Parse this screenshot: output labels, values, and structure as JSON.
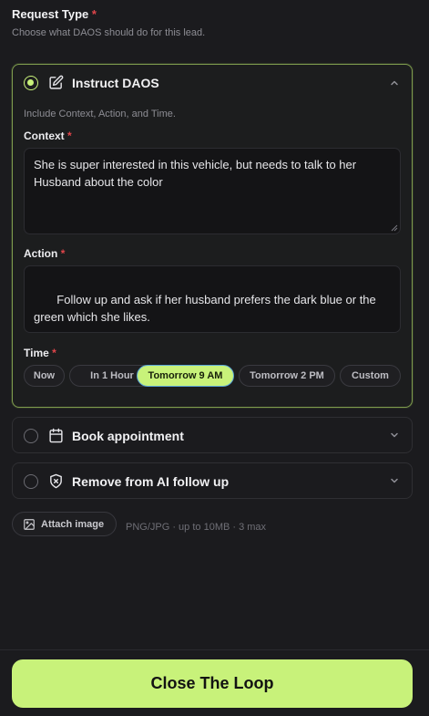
{
  "request_type": {
    "title": "Request Type",
    "required_mark": "*",
    "subtitle": "Choose what DAOS should do for this lead."
  },
  "instruct": {
    "title": "Instruct DAOS",
    "icon": "pencil-square-icon",
    "selected": true,
    "expanded": true,
    "hint": "Include Context, Action, and Time.",
    "context_label": "Context",
    "context_value": "She is super interested in this vehicle, but needs to talk to her Husband about the color",
    "action_label": "Action",
    "action_value": " Follow up and ask if her husband prefers the dark blue or the green which she likes.",
    "time_label": "Time",
    "time_options": [
      "Now",
      "In 1 Hour",
      "Tomorrow 9 AM",
      "Tomorrow 2 PM",
      "Custom"
    ],
    "time_selected": "Tomorrow 9 AM"
  },
  "book": {
    "title": "Book appointment",
    "icon": "calendar-icon",
    "selected": false,
    "expanded": false
  },
  "remove": {
    "title": "Remove from AI follow up",
    "icon": "shield-x-icon",
    "selected": false,
    "expanded": false
  },
  "attach": {
    "label": "Attach image",
    "icon": "image-icon",
    "meta": "PNG/JPG · up to 10MB · 3 max"
  },
  "cta": {
    "label": "Close The Loop"
  },
  "colors": {
    "accent": "#c8f27a",
    "required": "#e0454a",
    "background": "#1b1b1e",
    "active_border": "#7f9c4e",
    "selected_chip_outline": "#5aa6d8"
  }
}
